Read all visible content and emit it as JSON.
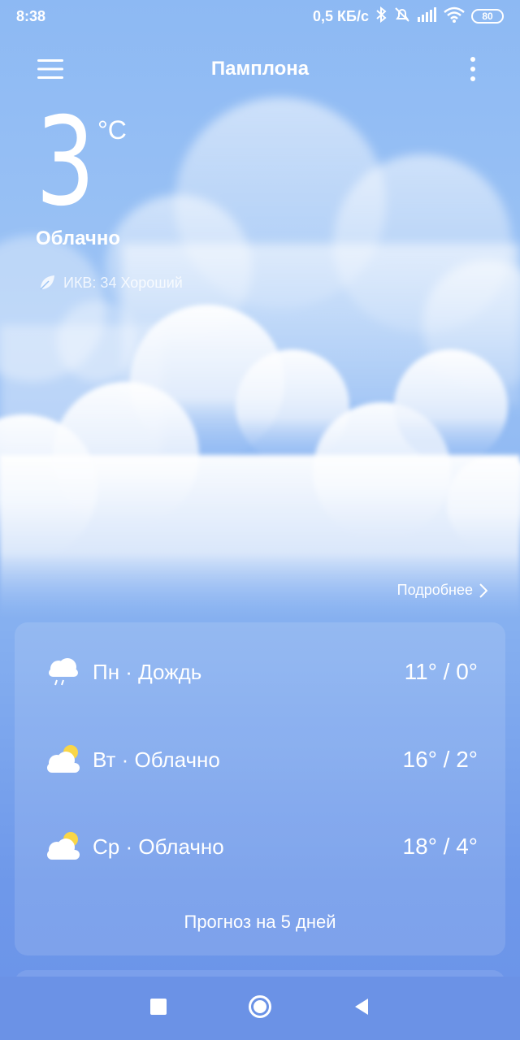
{
  "status_bar": {
    "time": "8:38",
    "network_speed": "0,5 КБ/с",
    "battery": "80"
  },
  "header": {
    "city": "Памплона"
  },
  "current": {
    "temperature": "3",
    "unit": "°C",
    "condition": "Облачно",
    "aqi_text": "ИКВ: 34 Хороший"
  },
  "more_link": "Подробнее",
  "forecast": {
    "rows": [
      {
        "icon": "rain-cloud-icon",
        "label": "Пн · Дождь",
        "range": "11° / 0°"
      },
      {
        "icon": "partly-cloudy-icon",
        "label": "Вт · Облачно",
        "range": "16° / 2°"
      },
      {
        "icon": "partly-cloudy-icon",
        "label": "Ср · Облачно",
        "range": "18° / 4°"
      }
    ],
    "footer": "Прогноз на 5 дней"
  },
  "colors": {
    "bg_top": "#8db9f3",
    "bg_bottom": "#6b93e8",
    "sun": "#f9d648"
  }
}
